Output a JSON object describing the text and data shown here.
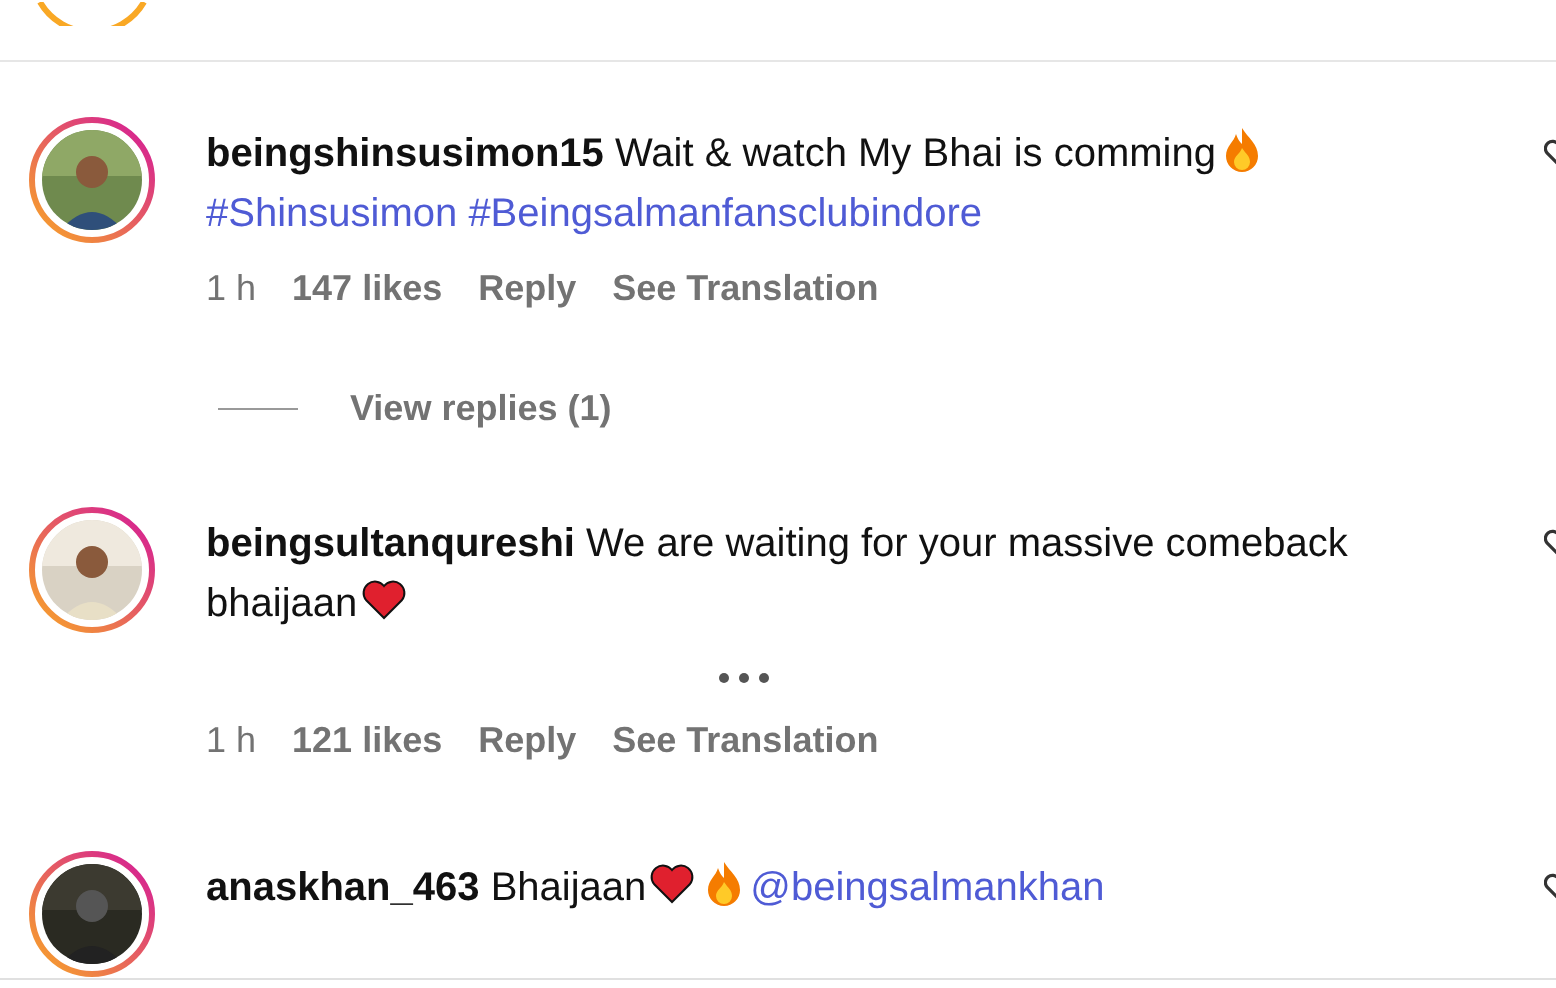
{
  "comments": [
    {
      "user": "beingshinsusimon15",
      "segments": [
        {
          "kind": "text",
          "text": "Wait & watch My Bhai is comming"
        },
        {
          "kind": "fire"
        },
        {
          "kind": "tag",
          "text": "#Shinsusimon"
        },
        {
          "kind": "tag",
          "text": "#Beingsalmanfansclubindore"
        }
      ],
      "time": "1 h",
      "likes": "147 likes",
      "reply": "Reply",
      "translate": "See Translation",
      "options_shown": false,
      "replies": "View replies (1)"
    },
    {
      "user": "beingsultanqureshi",
      "segments": [
        {
          "kind": "text",
          "text": "We are waiting for your massive comeback"
        },
        {
          "kind": "text",
          "text": "bhaijaan"
        },
        {
          "kind": "heart"
        }
      ],
      "time": "1 h",
      "likes": "121 likes",
      "reply": "Reply",
      "translate": "See Translation",
      "options_shown": true
    },
    {
      "user": "anaskhan_463",
      "segments": [
        {
          "kind": "text",
          "text": "Bhaijaan"
        },
        {
          "kind": "heart"
        },
        {
          "kind": "fire"
        },
        {
          "kind": "mention",
          "text": "@beingsalmankhan"
        }
      ]
    }
  ]
}
